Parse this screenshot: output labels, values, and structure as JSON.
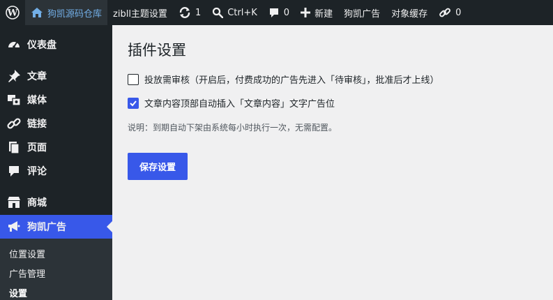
{
  "adminbar": {
    "site_name": "狗凯源码仓库",
    "theme_settings": "zibll主题设置",
    "updates_count": "1",
    "search_shortcut": "Ctrl+K",
    "comments_count": "0",
    "new_label": "新建",
    "ads_label": "狗凯广告",
    "cache_label": "对象缓存",
    "links_count": "0"
  },
  "sidebar": {
    "items": [
      {
        "label": "仪表盘",
        "icon": "dashboard-icon"
      },
      {
        "label": "文章",
        "icon": "pin-icon"
      },
      {
        "label": "媒体",
        "icon": "media-icon"
      },
      {
        "label": "链接",
        "icon": "link-icon"
      },
      {
        "label": "页面",
        "icon": "pages-icon"
      },
      {
        "label": "评论",
        "icon": "comment-icon"
      },
      {
        "label": "商城",
        "icon": "store-icon"
      },
      {
        "label": "狗凯广告",
        "icon": "megaphone-icon"
      }
    ],
    "submenu": [
      "位置设置",
      "广告管理",
      "设置"
    ]
  },
  "main": {
    "title": "插件设置",
    "options": [
      {
        "label": "投放需审核（开启后，付费成功的广告先进入「待审核」，批准后才上线）",
        "checked": false
      },
      {
        "label": "文章内容顶部自动插入「文章内容」文字广告位",
        "checked": true
      }
    ],
    "note": "说明：到期自动下架由系统每小时执行一次，无需配置。",
    "save_label": "保存设置"
  },
  "colors": {
    "accent": "#3858e9",
    "adminbar_bg": "#1d2327",
    "site_link": "#72aee6",
    "page_bg": "#f0f0f1"
  }
}
